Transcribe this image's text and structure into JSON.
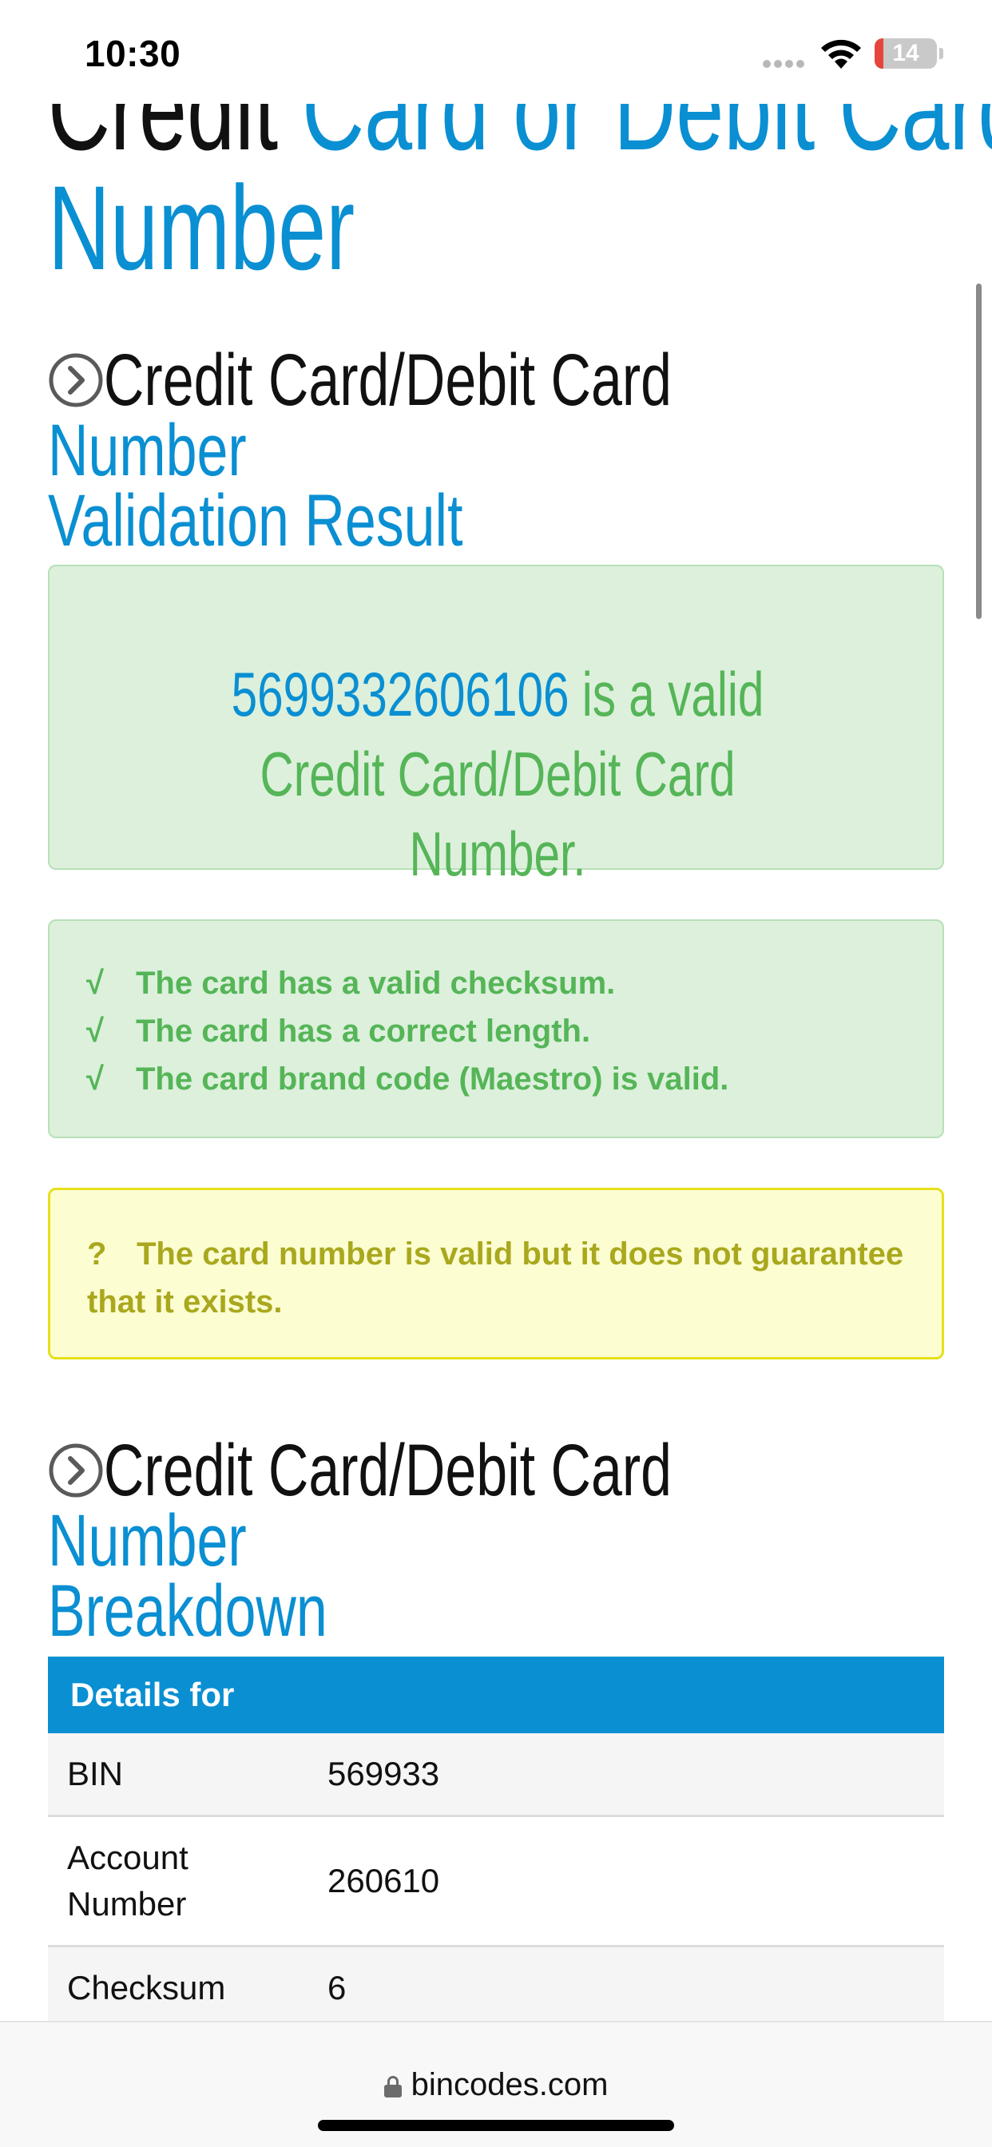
{
  "status_bar": {
    "time": "10:30",
    "battery_level": "14",
    "icons": [
      "cellular-signal-icon",
      "wifi-icon",
      "battery-icon"
    ]
  },
  "page": {
    "title_black": "Credit ",
    "title_blue": "Card or Debit Card",
    "title_line2": "Number"
  },
  "validation_section": {
    "heading_black": "Credit Card/Debit Card ",
    "heading_blue_1": "Number",
    "heading_blue_2": "Validation Result",
    "icon": "circle-chevron-right-icon"
  },
  "result": {
    "card_number": "5699332606106",
    "message": " is a valid Credit Card/Debit Card Number."
  },
  "checks": {
    "mark": "√",
    "items": [
      "The card has a valid checksum.",
      "The card has a correct length.",
      "The card brand code (Maestro) is valid."
    ]
  },
  "warning": {
    "mark": "?",
    "text": "The card number is valid but it does not guarantee that it exists."
  },
  "breakdown_section": {
    "heading_black": "Credit Card/Debit Card ",
    "heading_blue_1": "Number",
    "heading_blue_2": "Breakdown",
    "icon": "circle-chevron-right-icon"
  },
  "details_table": {
    "header": "Details for",
    "rows": [
      {
        "label": "BIN",
        "value": "569933"
      },
      {
        "label": "Account Number",
        "value": "260610"
      },
      {
        "label": "Checksum",
        "value": "6"
      }
    ]
  },
  "address_bar": {
    "url": "bincodes.com"
  },
  "colors": {
    "brand_blue": "#0a8fd2",
    "success_green": "#55b557",
    "success_bg": "#dcf0dc",
    "warning_text": "#a9a81e",
    "warning_bg": "#fdfdd2",
    "warning_border": "#e6e01a"
  }
}
